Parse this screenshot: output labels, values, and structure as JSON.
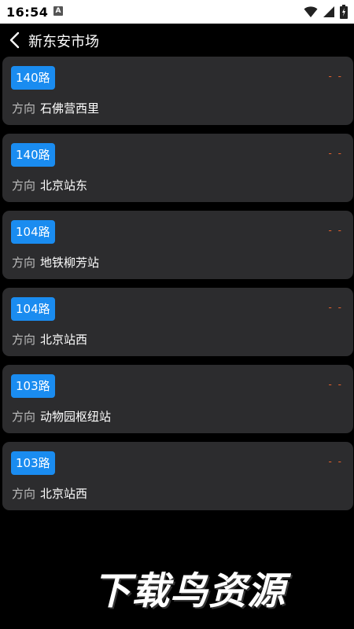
{
  "status_bar": {
    "time": "16:54",
    "notification_icon": "A",
    "icons": [
      "wifi-icon",
      "signal-icon",
      "battery-icon"
    ]
  },
  "header": {
    "back_icon": "chevron-left-icon",
    "title": "新东安市场"
  },
  "direction_prefix": "方向",
  "routes": [
    {
      "route": "140路",
      "destination": "石佛营西里",
      "eta": "- -"
    },
    {
      "route": "140路",
      "destination": "北京站东",
      "eta": "- -"
    },
    {
      "route": "104路",
      "destination": "地铁柳芳站",
      "eta": "- -"
    },
    {
      "route": "104路",
      "destination": "北京站西",
      "eta": "- -"
    },
    {
      "route": "103路",
      "destination": "动物园枢纽站",
      "eta": "- -"
    },
    {
      "route": "103路",
      "destination": "北京站西",
      "eta": "- -"
    }
  ],
  "watermark": "下载鸟资源",
  "colors": {
    "background": "#000000",
    "card": "#2c2c2e",
    "badge": "#1a8cf0",
    "eta": "#e8622c"
  }
}
